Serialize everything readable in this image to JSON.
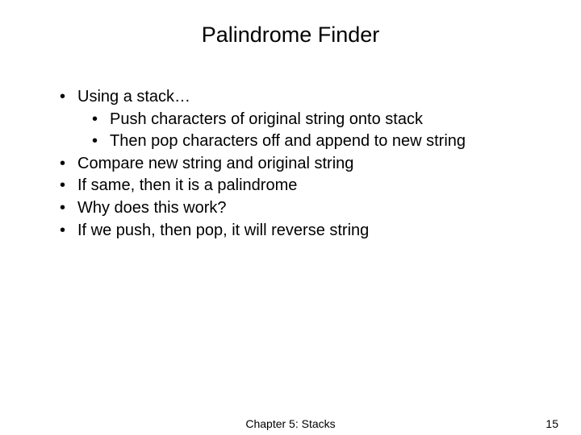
{
  "title": "Palindrome Finder",
  "bullets": {
    "b0": "Using a stack…",
    "b0_0": "Push characters of original string onto stack",
    "b0_1": "Then pop characters off and append to new string",
    "b1": "Compare new string and original string",
    "b2": "If same, then it is a palindrome",
    "b3": "Why does this work?",
    "b4": "If we push, then pop, it will reverse string"
  },
  "footer": {
    "chapter": "Chapter 5: Stacks",
    "page": "15"
  }
}
